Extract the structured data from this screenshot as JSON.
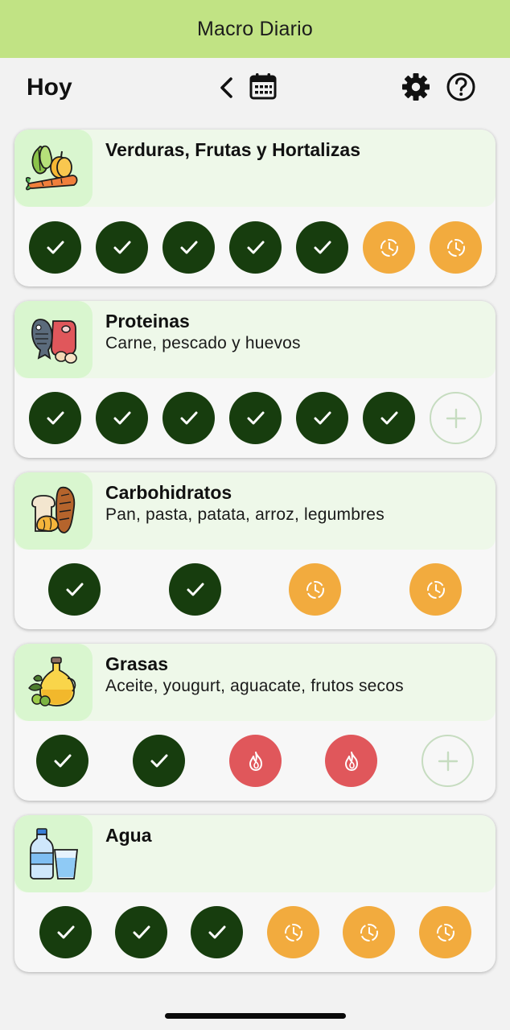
{
  "app": {
    "title": "Macro Diario"
  },
  "toolbar": {
    "today_label": "Hoy",
    "icons": [
      "chevron-left-icon",
      "calendar-icon",
      "gear-icon",
      "help-icon"
    ]
  },
  "colors": {
    "header_bg": "#c1e384",
    "done": "#173d0e",
    "pending": "#f2ab3e",
    "fire": "#e0575b",
    "add_border": "#c6dcc0",
    "card_head_bg": "#eef8e9",
    "thumb_bg": "#d9f6cf"
  },
  "categories": [
    {
      "title": "Verduras, Frutas y Hortalizas",
      "subtitle": "",
      "icon": "vegetables-icon",
      "slots": [
        "done",
        "done",
        "done",
        "done",
        "done",
        "pending",
        "pending"
      ]
    },
    {
      "title": "Proteinas",
      "subtitle": "Carne, pescado y huevos",
      "icon": "protein-icon",
      "slots": [
        "done",
        "done",
        "done",
        "done",
        "done",
        "done",
        "add"
      ]
    },
    {
      "title": "Carbohidratos",
      "subtitle": "Pan, pasta, patata, arroz, legumbres",
      "icon": "bread-icon",
      "slots": [
        "done",
        "done",
        "pending",
        "pending"
      ]
    },
    {
      "title": "Grasas",
      "subtitle": "Aceite, yougurt, aguacate, frutos secos",
      "icon": "oil-icon",
      "slots": [
        "done",
        "done",
        "fire",
        "fire",
        "add"
      ]
    },
    {
      "title": "Agua",
      "subtitle": "",
      "icon": "water-icon",
      "slots": [
        "done",
        "done",
        "done",
        "pending",
        "pending",
        "pending"
      ]
    }
  ]
}
